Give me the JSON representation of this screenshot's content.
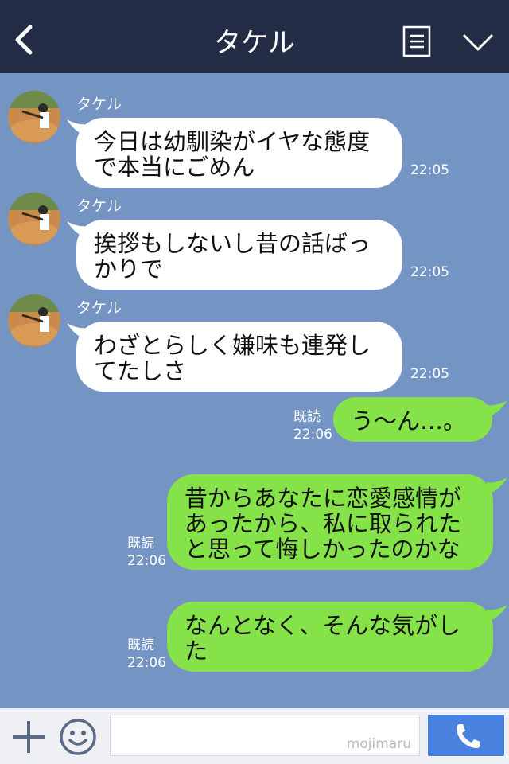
{
  "header": {
    "title": "タケル"
  },
  "messages_in": [
    {
      "sender": "タケル",
      "text": "今日は幼馴染がイヤな態度で本当にごめん",
      "time": "22:05"
    },
    {
      "sender": "タケル",
      "text": "挨拶もしないし昔の話ばっかりで",
      "time": "22:05"
    },
    {
      "sender": "タケル",
      "text": "わざとらしく嫌味も連発してたしさ",
      "time": "22:05"
    }
  ],
  "messages_out": [
    {
      "text": "う～ん…。",
      "read": "既読",
      "time": "22:06"
    },
    {
      "text": "昔からあなたに恋愛感情があったから、私に取られたと思って悔しかったのかな",
      "read": "既読",
      "time": "22:06"
    },
    {
      "text": "なんとなく、そんな気がした",
      "read": "既読",
      "time": "22:06"
    }
  ],
  "input": {
    "watermark": "mojimaru"
  },
  "colors": {
    "header_bg": "#232c45",
    "chat_bg": "#7494c3",
    "bubble_in": "#ffffff",
    "bubble_out": "#85e249",
    "call_button": "#4a82e0"
  },
  "icons": [
    "back-arrow-icon",
    "menu-list-icon",
    "chevron-down-icon",
    "plus-icon",
    "emoji-icon",
    "phone-icon"
  ]
}
